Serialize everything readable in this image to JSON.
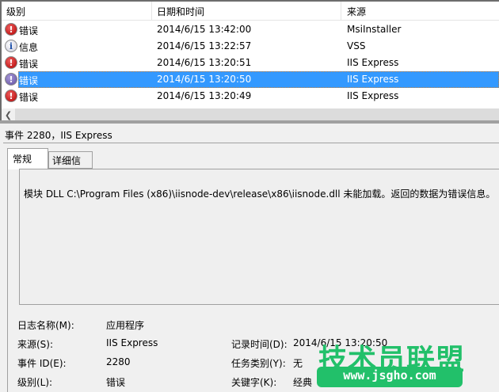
{
  "columns": {
    "level": "级别",
    "datetime": "日期和时间",
    "source": "来源"
  },
  "events": [
    {
      "icon": "error-icon",
      "level": "错误",
      "datetime": "2014/6/15 13:42:00",
      "source": "MsiInstaller"
    },
    {
      "icon": "info-icon",
      "level": "信息",
      "datetime": "2014/6/15 13:22:57",
      "source": "VSS"
    },
    {
      "icon": "error-icon",
      "level": "错误",
      "datetime": "2014/6/15 13:20:51",
      "source": "IIS Express"
    },
    {
      "icon": "error-icon",
      "level": "错误",
      "datetime": "2014/6/15 13:20:50",
      "source": "IIS Express",
      "selected": true
    },
    {
      "icon": "error-icon",
      "level": "错误",
      "datetime": "2014/6/15 13:20:49",
      "source": "IIS Express"
    }
  ],
  "detail": {
    "title": "事件 2280，IIS Express",
    "tabs": [
      "常规",
      "详细信息"
    ],
    "message": "模块 DLL C:\\Program Files (x86)\\iisnode-dev\\release\\x86\\iisnode.dll 未能加载。返回的数据为错误信息。",
    "fields": {
      "log_name_label": "日志名称(M):",
      "log_name": "应用程序",
      "source_label": "来源(S):",
      "source": "IIS Express",
      "event_id_label": "事件 ID(E):",
      "event_id": "2280",
      "level_label": "级别(L):",
      "level": "错误",
      "logged_label": "记录时间(D):",
      "logged": "2014/6/15 13:20:50",
      "task_label": "任务类别(Y):",
      "task": "无",
      "keywords_label": "关键字(K):",
      "keywords": "经典"
    }
  },
  "watermark": {
    "text": "技术员联盟",
    "url": "www.jsgho.com"
  },
  "colors": {
    "selection": "#3399ff",
    "watermark": "#22c06a"
  }
}
